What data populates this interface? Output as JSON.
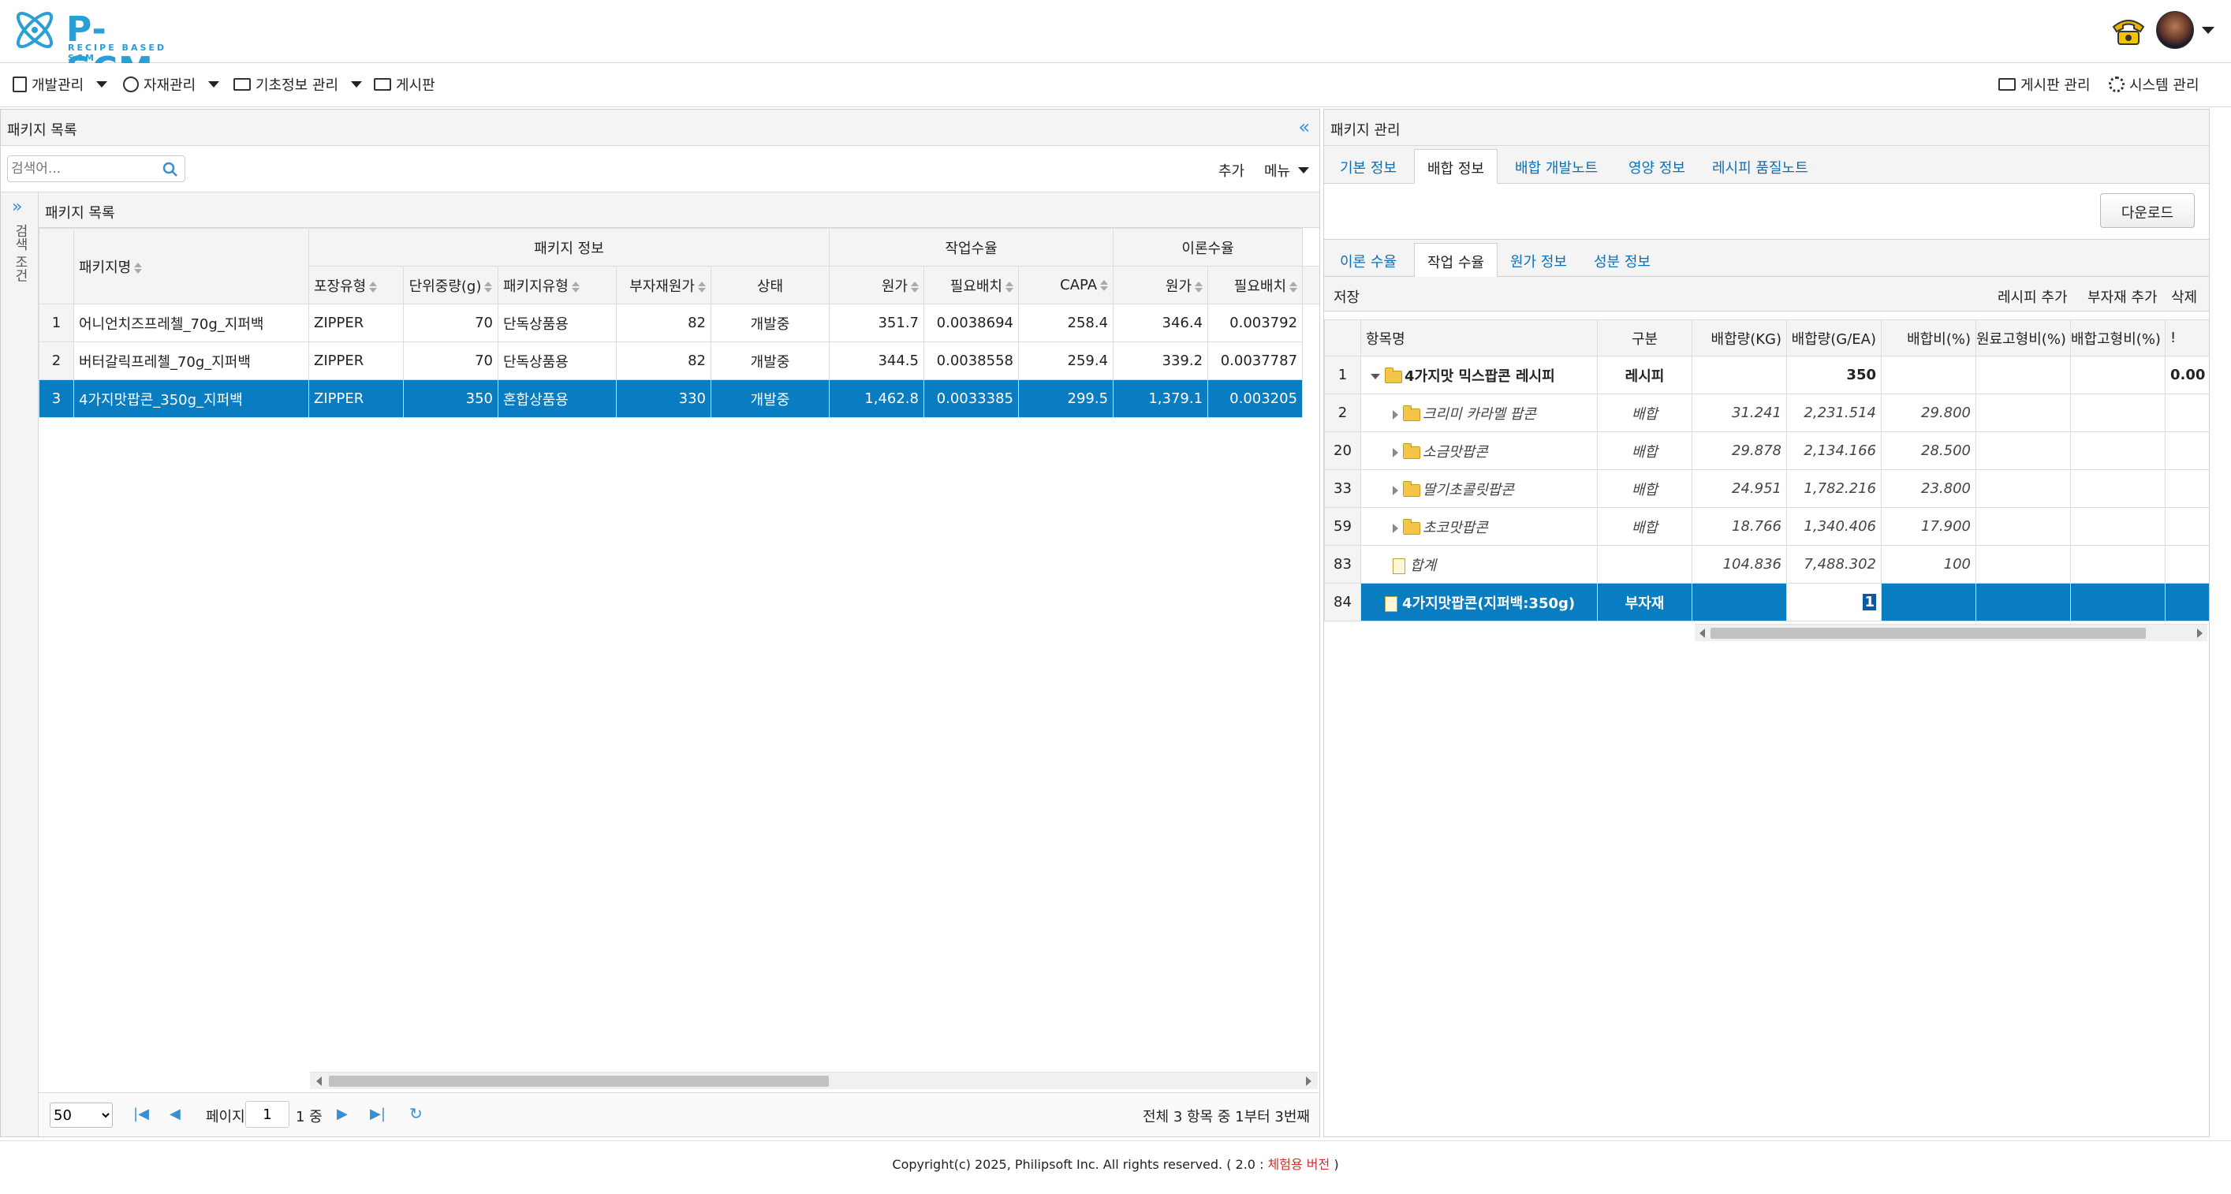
{
  "app": {
    "logo": "P-SCM",
    "logo_sub": "RECIPE BASED SCM"
  },
  "menu": {
    "left": [
      {
        "label": "개발관리"
      },
      {
        "label": "자재관리"
      },
      {
        "label": "기초정보 관리"
      },
      {
        "label": "게시판"
      }
    ],
    "right": [
      {
        "label": "게시판 관리"
      },
      {
        "label": "시스템 관리"
      }
    ]
  },
  "left_panel": {
    "title": "패키지 목록",
    "collapse_icon": "double-chevron-left-icon",
    "search_placeholder": "검색어...",
    "add_label": "추가",
    "menu_label": "메뉴",
    "search_conditions_label": "검색 조건",
    "grid_title": "패키지 목록",
    "group_headers": [
      "패키지 정보",
      "작업수율",
      "이론수율"
    ],
    "columns": [
      "패키지명",
      "포장유형",
      "단위중량(g)",
      "패키지유형",
      "부자재원가",
      "상태",
      "원가",
      "필요배치",
      "CAPA",
      "원가",
      "필요배치"
    ],
    "rows": [
      {
        "no": "1",
        "name": "어니언치즈프레첼_70g_지퍼백",
        "pack": "ZIPPER",
        "weight": "70",
        "ptype": "단독상품용",
        "subcost": "82",
        "status": "개발중",
        "wcost": "351.7",
        "wbatch": "0.0038694",
        "capa": "258.4",
        "tcost": "346.4",
        "tbatch": "0.003792"
      },
      {
        "no": "2",
        "name": "버터갈릭프레첼_70g_지퍼백",
        "pack": "ZIPPER",
        "weight": "70",
        "ptype": "단독상품용",
        "subcost": "82",
        "status": "개발중",
        "wcost": "344.5",
        "wbatch": "0.0038558",
        "capa": "259.4",
        "tcost": "339.2",
        "tbatch": "0.0037787"
      },
      {
        "no": "3",
        "name": "4가지맛팝콘_350g_지퍼백",
        "pack": "ZIPPER",
        "weight": "350",
        "ptype": "혼합상품용",
        "subcost": "330",
        "status": "개발중",
        "wcost": "1,462.8",
        "wbatch": "0.0033385",
        "capa": "299.5",
        "tcost": "1,379.1",
        "tbatch": "0.003205"
      }
    ],
    "selected_row": 3,
    "pager": {
      "page_size": "50",
      "page_label": "페이지",
      "page": "1",
      "of_label": "1 중",
      "summary": "전체 3 항목 중 1부터 3번째"
    }
  },
  "right_panel": {
    "title": "패키지 관리",
    "tabs": [
      "기본 정보",
      "배합 정보",
      "배합 개발노트",
      "영양 정보",
      "레시피 품질노트"
    ],
    "active_tab": 1,
    "download_label": "다운로드",
    "subtabs": [
      "이론 수율",
      "작업 수율",
      "원가 정보",
      "성분 정보"
    ],
    "active_subtab": 1,
    "toolbar": {
      "save": "저장",
      "add_recipe": "레시피 추가",
      "add_sub": "부자재 추가",
      "delete": "삭제"
    },
    "columns": [
      "항목명",
      "구분",
      "배합량(KG)",
      "배합량(G/EA)",
      "배합비(%)",
      "원료고형비(%)",
      "배합고형비(%)"
    ],
    "rows": [
      {
        "no": "1",
        "name": "4가지맛 믹스팝콘 레시피",
        "type": "레시피",
        "kg": "",
        "gea": "350",
        "ratio": "",
        "r1": "",
        "r2": "",
        "extra": "0.00",
        "level": 0,
        "icon": "folder",
        "bold": true,
        "expanded": true
      },
      {
        "no": "2",
        "name": "크리미 카라멜 팝콘",
        "type": "배합",
        "kg": "31.241",
        "gea": "2,231.514",
        "ratio": "29.800",
        "level": 1,
        "icon": "folder",
        "italic": true
      },
      {
        "no": "20",
        "name": "소금맛팝콘",
        "type": "배합",
        "kg": "29.878",
        "gea": "2,134.166",
        "ratio": "28.500",
        "level": 1,
        "icon": "folder",
        "italic": true
      },
      {
        "no": "33",
        "name": "딸기초콜릿팝콘",
        "type": "배합",
        "kg": "24.951",
        "gea": "1,782.216",
        "ratio": "23.800",
        "level": 1,
        "icon": "folder",
        "italic": true
      },
      {
        "no": "59",
        "name": "초코맛팝콘",
        "type": "배합",
        "kg": "18.766",
        "gea": "1,340.406",
        "ratio": "17.900",
        "level": 1,
        "icon": "folder",
        "italic": true
      },
      {
        "no": "83",
        "name": "합계",
        "type": "",
        "kg": "104.836",
        "gea": "7,488.302",
        "ratio": "100",
        "level": 1,
        "icon": "doc",
        "italic": true
      },
      {
        "no": "84",
        "name": "4가지맛팝콘(지퍼백:350g)",
        "type": "부자재",
        "kg": "",
        "gea": "1",
        "ratio": "",
        "level": 0,
        "icon": "doc",
        "bold": true
      }
    ],
    "selected_row_no": "84"
  },
  "footer": {
    "copyright": "Copyright(c) 2025, Philipsoft Inc. All rights reserved. ( 2.0 : ",
    "edition": "체험용 버전",
    "close": " )",
    "edition_color": "#d0312d"
  },
  "colors": {
    "accent": "#0a7cc1",
    "link": "#0a70b8"
  }
}
